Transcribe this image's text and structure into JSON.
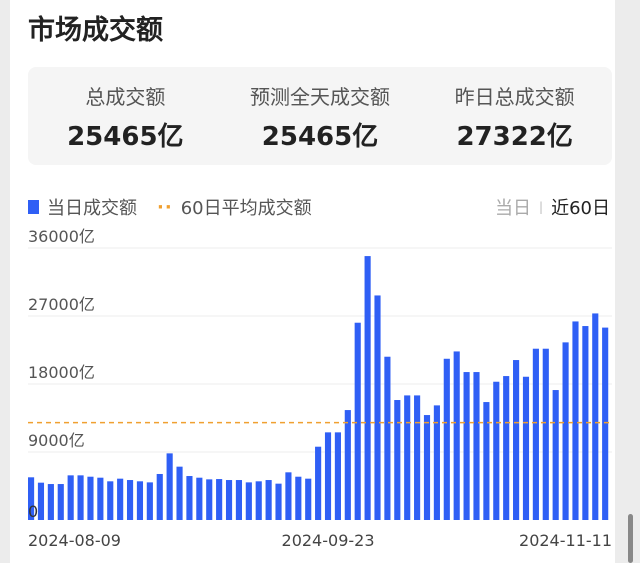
{
  "header": {
    "title": "市场成交额"
  },
  "stats": [
    {
      "label": "总成交额",
      "value": "25465亿"
    },
    {
      "label": "预测全天成交额",
      "value": "25465亿"
    },
    {
      "label": "昨日总成交额",
      "value": "27322亿"
    }
  ],
  "legend": {
    "bar": "当日成交额",
    "line": "60日平均成交额"
  },
  "range": {
    "options": [
      "当日",
      "近60日"
    ],
    "selected": "近60日"
  },
  "colors": {
    "bar": "#2f5ff5",
    "avg": "#f0a030"
  },
  "chart_data": {
    "type": "bar",
    "title": "市场成交额",
    "series": [
      {
        "name": "当日成交额",
        "unit": "亿",
        "values": [
          5650,
          4940,
          4760,
          4760,
          5910,
          5910,
          5730,
          5600,
          5120,
          5470,
          5290,
          5120,
          4980,
          6090,
          8820,
          7060,
          5820,
          5600,
          5380,
          5420,
          5290,
          5290,
          4980,
          5120,
          5290,
          4810,
          6310,
          5730,
          5470,
          9700,
          11600,
          11600,
          14550,
          26110,
          34930,
          29720,
          21610,
          15880,
          16490,
          16490,
          13890,
          15170,
          21340,
          22310,
          19580,
          19580,
          15610,
          18300,
          19050,
          21170,
          18960,
          22670,
          22670,
          17200,
          23510,
          26280,
          25670,
          27340,
          25465
        ]
      }
    ],
    "average": {
      "name": "60日平均成交额",
      "value": 12880
    },
    "ylim": [
      0,
      36000
    ],
    "yticks": [
      {
        "v": 0,
        "label": "0"
      },
      {
        "v": 9000,
        "label": "9000亿"
      },
      {
        "v": 18000,
        "label": "18000亿"
      },
      {
        "v": 27000,
        "label": "27000亿"
      },
      {
        "v": 36000,
        "label": "36000亿"
      }
    ],
    "xticks": [
      {
        "i": 0,
        "label": "2024-08-09"
      },
      {
        "i": 30,
        "label": "2024-09-23"
      },
      {
        "i": 58,
        "label": "2024-11-11"
      }
    ],
    "grid": true,
    "legend_position": "top-left"
  }
}
